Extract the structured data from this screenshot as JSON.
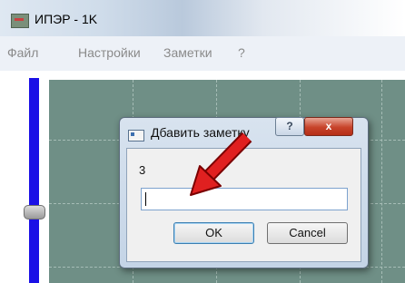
{
  "window": {
    "title": "ИПЭР - 1K",
    "icon": "app-icon"
  },
  "menu": {
    "items": [
      {
        "label": "Файл"
      },
      {
        "label": "Настройки"
      },
      {
        "label": "Заметки"
      },
      {
        "label": "?"
      }
    ]
  },
  "slider": {
    "color": "#1a10e6"
  },
  "canvas": {
    "background": "#6f8f86"
  },
  "dialog": {
    "title": "Дбавить заметку",
    "help_label": "?",
    "close_label": "x",
    "prompt": "3",
    "input_value": "",
    "ok_label": "OK",
    "cancel_label": "Cancel"
  },
  "annotation": {
    "type": "red-arrow",
    "color": "#e02020"
  }
}
